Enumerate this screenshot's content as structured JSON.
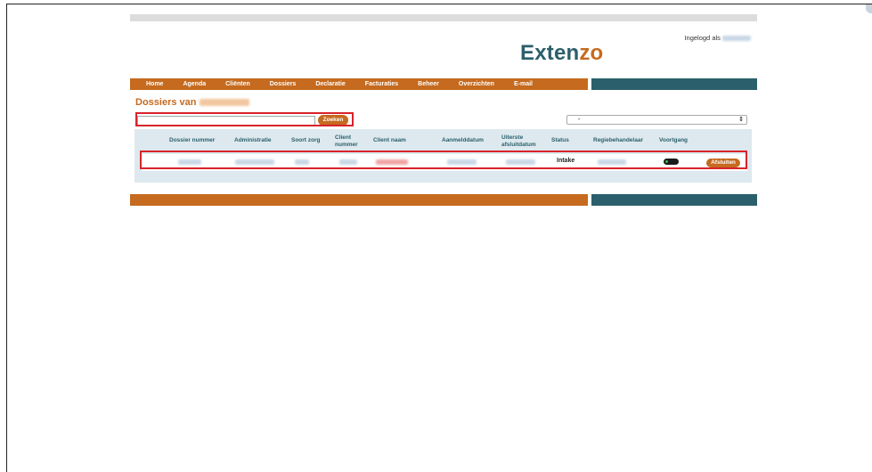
{
  "header": {
    "logo_part1": "Exten",
    "logo_part2": "zo",
    "login_prefix": "Ingelogd als"
  },
  "nav": [
    "Home",
    "Agenda",
    "Cliënten",
    "Dossiers",
    "Declaratie",
    "Facturaties",
    "Beheer",
    "Overzichten",
    "E-mail"
  ],
  "page": {
    "title_prefix": "Dossiers van",
    "search_button": "Zoeken",
    "select_value": "-",
    "select_arrow": "⇕"
  },
  "table": {
    "headers": [
      "Dossier nummer",
      "Administratie",
      "Soort zorg",
      "Client nummer",
      "Client naam",
      "Aanmelddatum",
      "Uiterste afsluitdatum",
      "Status",
      "Regiebehandelaar",
      "Voortgang"
    ],
    "row": {
      "status": "Intake",
      "action": "Afsluiten"
    }
  },
  "colors": {
    "orange": "#c56a1f",
    "teal": "#2b5f6b",
    "highlight": "#d8232a"
  }
}
